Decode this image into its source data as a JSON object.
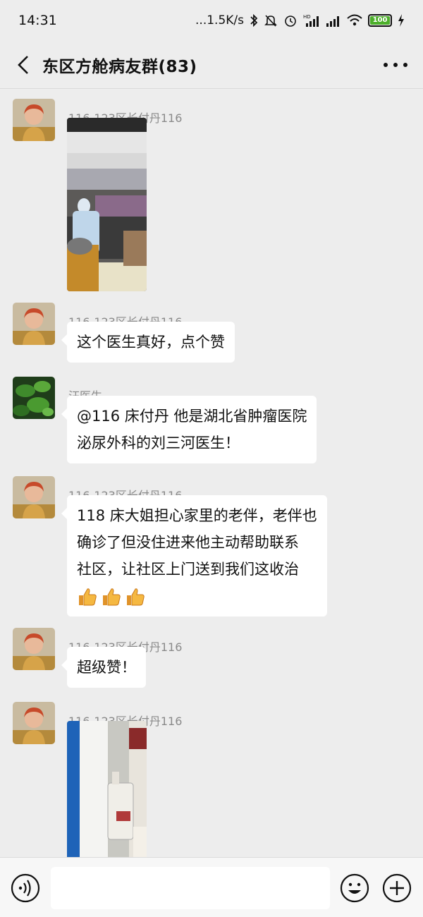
{
  "status_bar": {
    "time": "14:31",
    "network_speed": "...1.5K/s",
    "battery_level": "100"
  },
  "header": {
    "title": "东区方舱病友群(83)"
  },
  "messages": [
    {
      "type": "image",
      "sender": "116-123区长付丹116",
      "avatar": "user-photo-avatar",
      "image": "photo-doctor-in-ward"
    },
    {
      "type": "text",
      "sender": "116-123区长付丹116",
      "avatar": "user-photo-avatar",
      "lines": [
        "这个医生真好，点个赞"
      ]
    },
    {
      "type": "text",
      "sender": "汪医生",
      "avatar": "green-leaves-avatar",
      "lines": [
        "@116 床付丹  他是湖北省肿瘤医院",
        "泌尿外科的刘三河医生！"
      ]
    },
    {
      "type": "text",
      "sender": "116-123区长付丹116",
      "avatar": "user-photo-avatar",
      "lines": [
        "118 床大姐担心家里的老伴，老伴也",
        "确诊了但没住进来他主动帮助联系",
        "社区，让社区上门送到我们这收治"
      ],
      "emoji": [
        "thumbs-up-icon",
        "thumbs-up-icon",
        "thumbs-up-icon"
      ]
    },
    {
      "type": "text",
      "sender": "116-123区长付丹116",
      "avatar": "user-photo-avatar",
      "lines": [
        "超级赞！"
      ]
    },
    {
      "type": "image",
      "sender": "116-123区长付丹116",
      "avatar": "user-photo-avatar",
      "image": "photo-hand-sanitizer"
    }
  ],
  "input_bar": {
    "value": "",
    "placeholder": ""
  },
  "colors": {
    "background": "#ededed",
    "bubble": "#ffffff",
    "battery": "#4caf2a"
  }
}
